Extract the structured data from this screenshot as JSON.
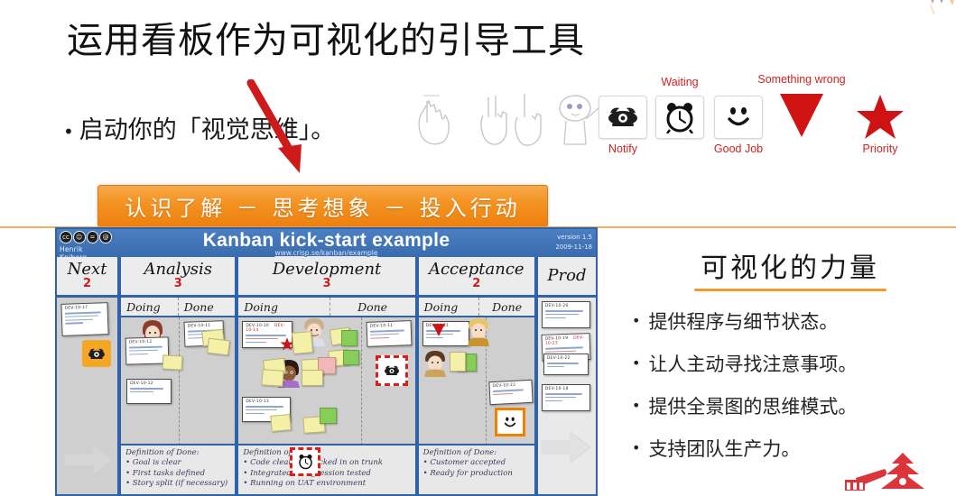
{
  "slide": {
    "title": "运用看板作为可视化的引导工具",
    "lead_bullet": "启动你的「视觉思维」。",
    "banner_text": "认识了解 － 思考想象 － 投入行动"
  },
  "icon_strip": {
    "items": [
      {
        "name": "hand-pointing-sketch",
        "glyph": "",
        "caption": "",
        "caption_pos": "none",
        "type": "sketch"
      },
      {
        "name": "two-hands-counting-sketch",
        "glyph": "",
        "caption": "",
        "caption_pos": "none",
        "type": "sketch"
      },
      {
        "name": "person-raising-hand-sketch",
        "glyph": "",
        "caption": "",
        "caption_pos": "none",
        "type": "sketch"
      },
      {
        "name": "telephone-icon",
        "glyph": "☎",
        "caption": "Notify",
        "caption_pos": "below",
        "type": "tile"
      },
      {
        "name": "alarm-clock-icon",
        "glyph": "⏰",
        "caption": "Waiting",
        "caption_pos": "above",
        "type": "tile"
      },
      {
        "name": "smiley-face-icon",
        "glyph": "☺",
        "caption": "Good Job",
        "caption_pos": "below",
        "type": "tile"
      },
      {
        "name": "red-down-triangle-icon",
        "glyph": "▼",
        "caption": "Something wrong",
        "caption_pos": "above",
        "type": "shape"
      },
      {
        "name": "red-star-icon",
        "glyph": "★",
        "caption": "Priority",
        "caption_pos": "below",
        "type": "shape"
      }
    ],
    "caption_color": "#d32020"
  },
  "right_column": {
    "heading": "可视化的力量",
    "rule_color": "#ef9a2b",
    "bullets": [
      "提供程序与细节状态。",
      "让人主动寻找注意事项。",
      "提供全景图的思维模式。",
      "支持团队生产力。"
    ]
  },
  "kanban": {
    "title": "Kanban kick-start example",
    "author": "Henrik Kniberg",
    "url": "www.crisp.se/kanban/example",
    "version": "version 1.5",
    "date": "2009-11-18",
    "header_color": "#3a6cb0",
    "columns": [
      {
        "name": "Next",
        "wip": "2",
        "sub": []
      },
      {
        "name": "Analysis",
        "wip": "3",
        "sub": [
          "Doing",
          "Done"
        ]
      },
      {
        "name": "Development",
        "wip": "3",
        "sub": [
          "Doing",
          "Done"
        ]
      },
      {
        "name": "Acceptance",
        "wip": "2",
        "sub": [
          "Doing",
          "Done"
        ]
      },
      {
        "name": "Prod",
        "wip": "",
        "sub": []
      }
    ],
    "definitions_of_done": [
      {
        "column": "Analysis",
        "title": "Definition of Done:",
        "items": [
          "Goal is clear",
          "First tasks defined",
          "Story split (if necessary)"
        ]
      },
      {
        "column": "Development",
        "title": "Definition of Done:",
        "items": [
          "Code clean & checked in on trunk",
          "Integrated & regression tested",
          "Running on UAT environment"
        ]
      },
      {
        "column": "Acceptance",
        "title": "Definition of Done:",
        "items": [
          "Customer accepted",
          "Ready for production"
        ]
      }
    ],
    "board_markers": [
      {
        "name": "telephone-marker-next",
        "glyph": "☎",
        "style": "orange"
      },
      {
        "name": "telephone-marker-dev-done",
        "glyph": "☎",
        "style": "reddash"
      },
      {
        "name": "alarm-clock-marker-dev",
        "glyph": "⏰",
        "style": "reddash"
      },
      {
        "name": "smiley-marker-acceptance",
        "glyph": "☺",
        "style": "orange2"
      },
      {
        "name": "red-star-marker-dev",
        "glyph": "★",
        "style": "plain"
      },
      {
        "name": "red-triangle-marker-acceptance",
        "glyph": "▼",
        "style": "plain"
      }
    ]
  }
}
